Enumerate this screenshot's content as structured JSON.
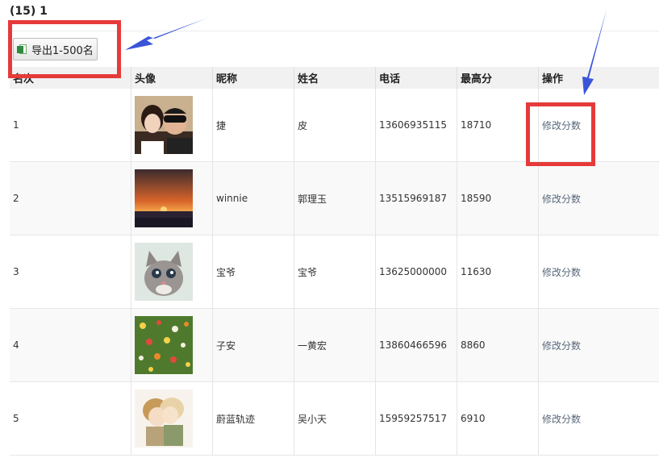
{
  "header": {
    "partial_text": "(15) 1"
  },
  "toolbar": {
    "export_label": "导出1-500名",
    "export_icon": "excel-icon"
  },
  "table": {
    "columns": [
      "名次",
      "头像",
      "昵称",
      "姓名",
      "电话",
      "最高分",
      "操作"
    ],
    "rows": [
      {
        "rank": "1",
        "avatar": "couple-photo",
        "nickname": "捷",
        "name": "皮",
        "phone": "13606935115",
        "score": "18710",
        "action": "修改分数"
      },
      {
        "rank": "2",
        "avatar": "sunset-photo",
        "nickname": "winnie",
        "name": "郭理玉",
        "phone": "13515969187",
        "score": "18590",
        "action": "修改分数"
      },
      {
        "rank": "3",
        "avatar": "kitten-photo",
        "nickname": "宝爷",
        "name": "宝爷",
        "phone": "13625000000",
        "score": "11630",
        "action": "修改分数"
      },
      {
        "rank": "4",
        "avatar": "flowers-photo",
        "nickname": "子安",
        "name": "一黄宏",
        "phone": "13860466596",
        "score": "8860",
        "action": "修改分数"
      },
      {
        "rank": "5",
        "avatar": "anime-couple-photo",
        "nickname": "蔚蓝轨迹",
        "name": "吴小天",
        "phone": "15959257517",
        "score": "6910",
        "action": "修改分数"
      }
    ]
  },
  "annotations": {
    "highlight_color": "#e63a3a",
    "arrow_color": "#3a55d8"
  }
}
